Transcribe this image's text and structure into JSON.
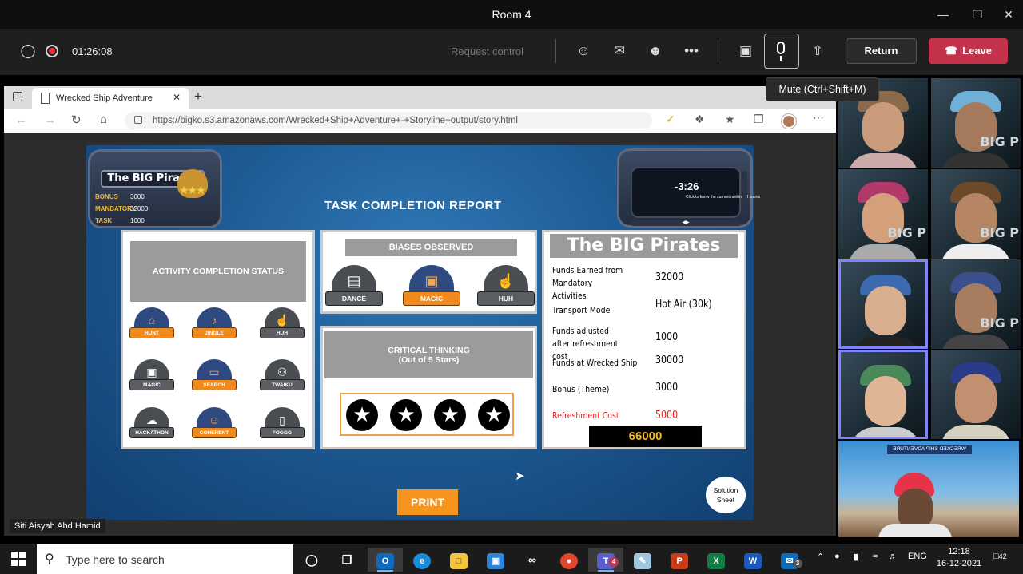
{
  "window": {
    "title": "Room 4"
  },
  "meeting": {
    "timer": "01:26:08",
    "request_control": "Request control",
    "return_label": "Return",
    "leave_label": "Leave",
    "mic_tooltip": "Mute (Ctrl+Shift+M)"
  },
  "browser": {
    "tab_title": "Wrecked Ship Adventure",
    "url": "https://bigko.s3.amazonaws.com/Wrecked+Ship+Adventure+-+Storyline+output/story.html"
  },
  "game": {
    "team_name": "The BIG Pirates",
    "stats": [
      {
        "label": "BONUS",
        "value": "3000"
      },
      {
        "label": "MANDATORY",
        "value": "32000"
      },
      {
        "label": "TASK",
        "value": "1000"
      }
    ],
    "timer": "-3:26",
    "timer_hint": "Click to know the current ranking of teams",
    "report_title": "TASK COMPLETION REPORT",
    "activity_header": "ACTIVITY COMPLETION STATUS",
    "activities": [
      {
        "label": "HUNT",
        "icon": "home-icon",
        "done": true
      },
      {
        "label": "JINGLE",
        "icon": "microphone-icon",
        "done": true
      },
      {
        "label": "HUH",
        "icon": "thumbs-up-icon",
        "done": false
      },
      {
        "label": "MAGIC",
        "icon": "image-icon",
        "done": false
      },
      {
        "label": "SEARCH",
        "icon": "laptop-icon",
        "done": true
      },
      {
        "label": "TWAIKU",
        "icon": "group-icon",
        "done": false
      },
      {
        "label": "HACKATHON",
        "icon": "cloud-icon",
        "done": false
      },
      {
        "label": "COHERENT",
        "icon": "person-icon",
        "done": true
      },
      {
        "label": "FOGGG",
        "icon": "phone-icon",
        "done": false
      }
    ],
    "biases_header": "BIASES OBSERVED",
    "biases": [
      {
        "label": "DANCE",
        "icon": "film-icon",
        "active": false
      },
      {
        "label": "MAGIC",
        "icon": "image-icon",
        "active": true
      },
      {
        "label": "HUH",
        "icon": "thumbs-up-icon",
        "active": false
      }
    ],
    "critical_header_line1": "CRITICAL THINKING",
    "critical_header_line2": "(Out of 5 Stars)",
    "stars_earned": 4,
    "summary_title": "The BIG Pirates",
    "summary": [
      {
        "label": "Funds Earned from Mandatory Activities",
        "value": "32000"
      },
      {
        "label": "Transport Mode",
        "value": "Hot Air (30k)"
      },
      {
        "label": "Funds adjusted after refreshment cost",
        "value": "1000"
      },
      {
        "label": "Funds at Wrecked Ship",
        "value": "30000"
      },
      {
        "label": "Bonus (Theme)",
        "value": "3000"
      },
      {
        "label": "Refreshment Cost",
        "value": "5000"
      }
    ],
    "total": "66000",
    "print_label": "PRINT",
    "solution_label": "Solution Sheet"
  },
  "presenter_name": "Siti Aisyah Abd Hamid",
  "gallery_watermark": "BIG P",
  "presenter_banner": "WRECKED SHIP ADVENTURE",
  "taskbar": {
    "search_placeholder": "Type here to search",
    "lang": "ENG",
    "time": "12:18",
    "date": "16-12-2021",
    "notifications": "42",
    "teams_badge": "4",
    "mail_badge": "3"
  },
  "colors": {
    "accent": "#f7941d",
    "leave": "#c4314b",
    "refreshment": "#e02020",
    "total_text": "#f5b81f"
  }
}
